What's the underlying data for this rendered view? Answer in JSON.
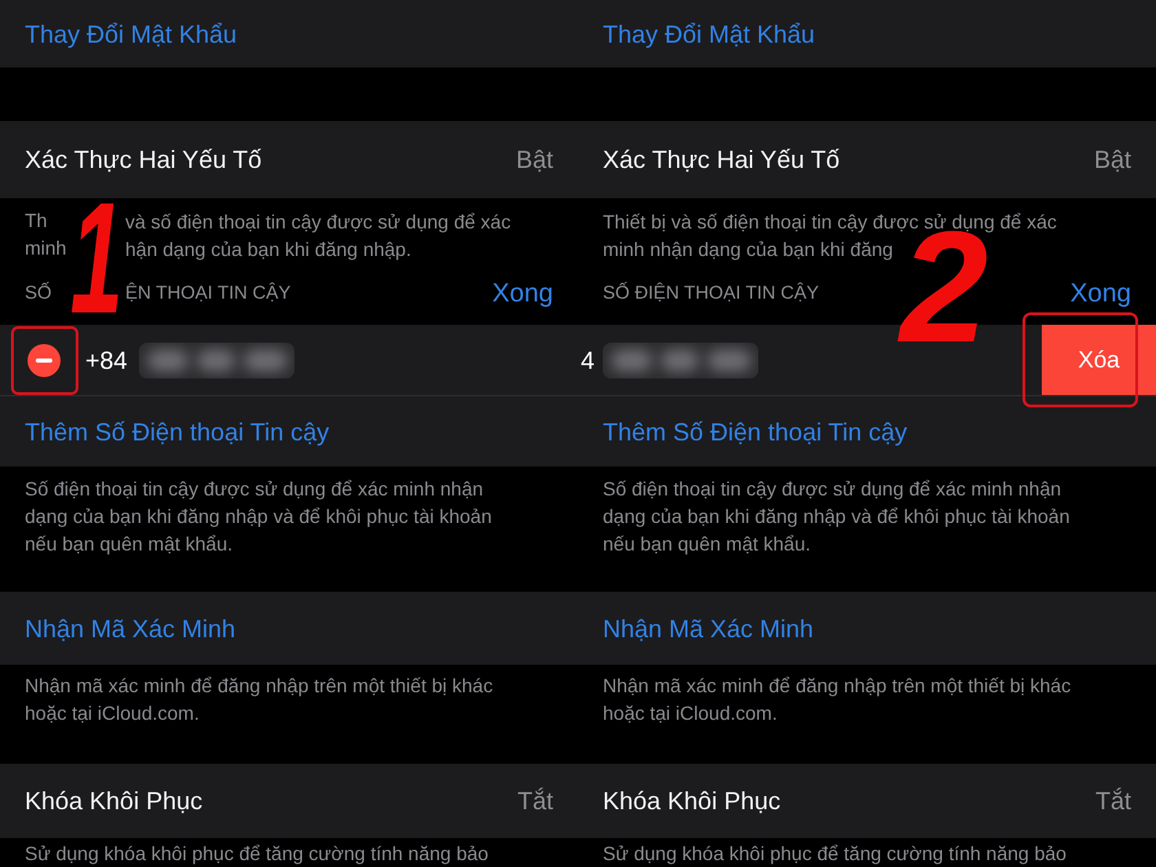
{
  "panels": [
    {
      "change_password": "Thay Đổi Mật Khẩu",
      "two_factor": {
        "label": "Xác Thực Hai Yếu Tố",
        "value": "Bật"
      },
      "two_factor_note": [
        [
          "Th",
          "và số điện thoại tin cậy được sử dụng để xác"
        ],
        [
          "minh",
          "hận dạng của bạn khi đăng nhập."
        ]
      ],
      "trusted_numbers_header": [
        "SỐ",
        "ỆN THOẠI TIN CẬY"
      ],
      "done_button": "Xong",
      "phone_row": {
        "kind": "editing",
        "prefix": "+84",
        "highlighted": true
      },
      "add_phone": "Thêm Số Điện thoại Tin cậy",
      "add_phone_note": "Số điện thoại tin cậy được sử dụng để xác minh nhận dạng của bạn khi đăng nhập và để khôi phục tài khoản nếu bạn quên mật khẩu.",
      "get_code": "Nhận Mã Xác Minh",
      "get_code_note": "Nhận mã xác minh để đăng nhập trên một thiết bị khác hoặc tại iCloud.com.",
      "recovery_key": {
        "label": "Khóa Khôi Phục",
        "value": "Tắt"
      },
      "recovery_note": "Sử dụng khóa khôi phục để tăng cường tính năng bảo",
      "step": "1"
    },
    {
      "change_password": "Thay Đổi Mật Khẩu",
      "two_factor": {
        "label": "Xác Thực Hai Yếu Tố",
        "value": "Bật"
      },
      "two_factor_note": [
        [
          "Thiết bị và số điện thoại tin cậy được sử dụng để xác"
        ],
        [
          "minh nhận dạng của bạn khi đăng"
        ]
      ],
      "trusted_numbers_header": [
        "SỐ ĐIỆN THOẠI TIN CẬY"
      ],
      "done_button": "Xong",
      "phone_row": {
        "kind": "swiped",
        "prefix": "4",
        "delete_label": "Xóa",
        "highlighted": true
      },
      "add_phone": "Thêm Số Điện thoại Tin cậy",
      "add_phone_note": "Số điện thoại tin cậy được sử dụng để xác minh nhận dạng của bạn khi đăng nhập và để khôi phục tài khoản nếu bạn quên mật khẩu.",
      "get_code": "Nhận Mã Xác Minh",
      "get_code_note": "Nhận mã xác minh để đăng nhập trên một thiết bị khác hoặc tại iCloud.com.",
      "recovery_key": {
        "label": "Khóa Khôi Phục",
        "value": "Tắt"
      },
      "recovery_note": "Sử dụng khóa khôi phục để tăng cường tính năng bảo",
      "step": "2"
    }
  ]
}
